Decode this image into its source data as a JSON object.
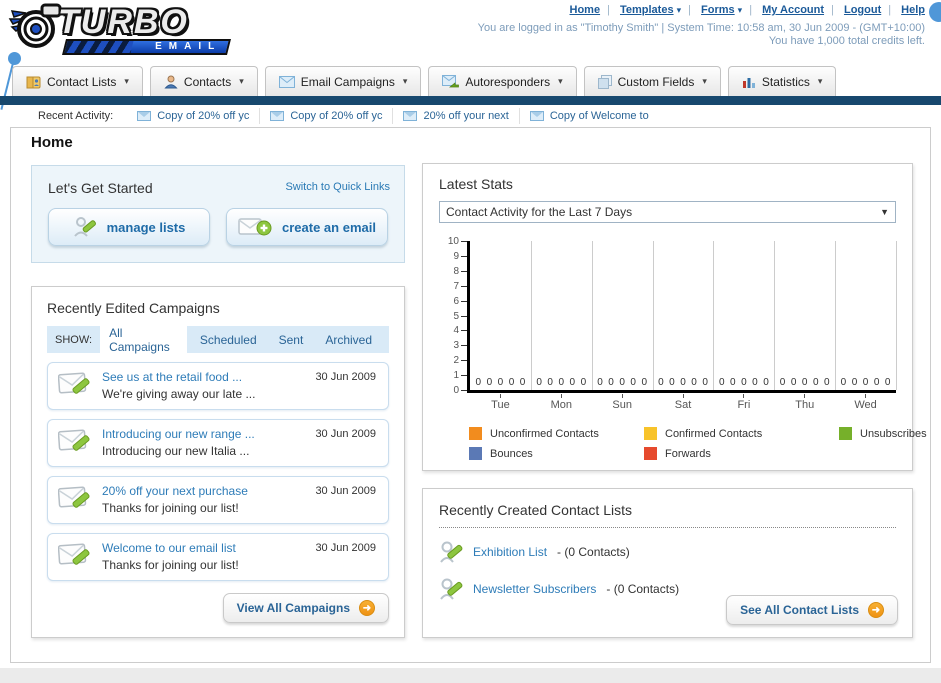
{
  "header": {
    "links": [
      {
        "label": "Home",
        "dropdown": false
      },
      {
        "label": "Templates",
        "dropdown": true
      },
      {
        "label": "Forms",
        "dropdown": true
      },
      {
        "label": "My Account",
        "dropdown": false
      },
      {
        "label": "Logout",
        "dropdown": false
      },
      {
        "label": "Help",
        "dropdown": false
      }
    ],
    "login_line": "You are logged in as \"Timothy Smith\" | System Time: 10:58 am, 30 Jun 2009 - (GMT+10:00)",
    "credits_line": "You have 1,000 total credits left.",
    "logo_text": "TURBO",
    "logo_sub": "EMAIL"
  },
  "nav": {
    "tabs": [
      {
        "label": "Contact Lists"
      },
      {
        "label": "Contacts"
      },
      {
        "label": "Email Campaigns"
      },
      {
        "label": "Autoresponders"
      },
      {
        "label": "Custom Fields"
      },
      {
        "label": "Statistics"
      }
    ]
  },
  "recent_activity": {
    "label": "Recent Activity:",
    "items": [
      {
        "label": "Copy of 20% off yc"
      },
      {
        "label": "Copy of 20% off yc"
      },
      {
        "label": "20% off your next"
      },
      {
        "label": "Copy of Welcome to"
      }
    ]
  },
  "page": {
    "title": "Home"
  },
  "get_started": {
    "title": "Let's Get Started",
    "switch_link": "Switch to Quick Links",
    "manage_lists_label": "manage lists",
    "create_email_label": "create an email"
  },
  "campaigns": {
    "title": "Recently Edited Campaigns",
    "show_label": "SHOW:",
    "tabs": [
      {
        "label": "All Campaigns",
        "active": true
      },
      {
        "label": "Scheduled",
        "active": false
      },
      {
        "label": "Sent",
        "active": false
      },
      {
        "label": "Archived",
        "active": false
      }
    ],
    "items": [
      {
        "title": "See us at the retail food ...",
        "subtitle": "We're giving away our late ...",
        "date": "30 Jun 2009"
      },
      {
        "title": "Introducing our new range ...",
        "subtitle": "Introducing our new Italia ...",
        "date": "30 Jun 2009"
      },
      {
        "title": "20% off your next purchase",
        "subtitle": "Thanks for joining our list!",
        "date": "30 Jun 2009"
      },
      {
        "title": "Welcome to our email list",
        "subtitle": "Thanks for joining our list!",
        "date": "30 Jun 2009"
      }
    ],
    "view_all_label": "View All Campaigns"
  },
  "stats": {
    "title": "Latest Stats",
    "dropdown_value": "Contact Activity for the Last 7 Days"
  },
  "chart_data": {
    "type": "bar",
    "title": "Contact Activity for the Last 7 Days",
    "categories": [
      "Tue",
      "Mon",
      "Sun",
      "Sat",
      "Fri",
      "Thu",
      "Wed"
    ],
    "series": [
      {
        "name": "Unconfirmed Contacts",
        "color": "#f28c1e",
        "values": [
          0,
          0,
          0,
          0,
          0,
          0,
          0
        ]
      },
      {
        "name": "Confirmed Contacts",
        "color": "#f8c32a",
        "values": [
          0,
          0,
          0,
          0,
          0,
          0,
          0
        ]
      },
      {
        "name": "Unsubscribes",
        "color": "#76b02a",
        "values": [
          0,
          0,
          0,
          0,
          0,
          0,
          0
        ]
      },
      {
        "name": "Bounces",
        "color": "#5b79b5",
        "values": [
          0,
          0,
          0,
          0,
          0,
          0,
          0
        ]
      },
      {
        "name": "Forwards",
        "color": "#e64a2e",
        "values": [
          0,
          0,
          0,
          0,
          0,
          0,
          0
        ]
      }
    ],
    "xlabel": "",
    "ylabel": "",
    "ylim": [
      0,
      10
    ],
    "grid": "vertical",
    "legend_position": "bottom"
  },
  "contact_lists": {
    "title": "Recently Created Contact Lists",
    "items": [
      {
        "name": "Exhibition List",
        "suffix": "- (0 Contacts)"
      },
      {
        "name": "Newsletter Subscribers",
        "suffix": "- (0 Contacts)"
      }
    ],
    "see_all_label": "See All Contact Lists"
  }
}
